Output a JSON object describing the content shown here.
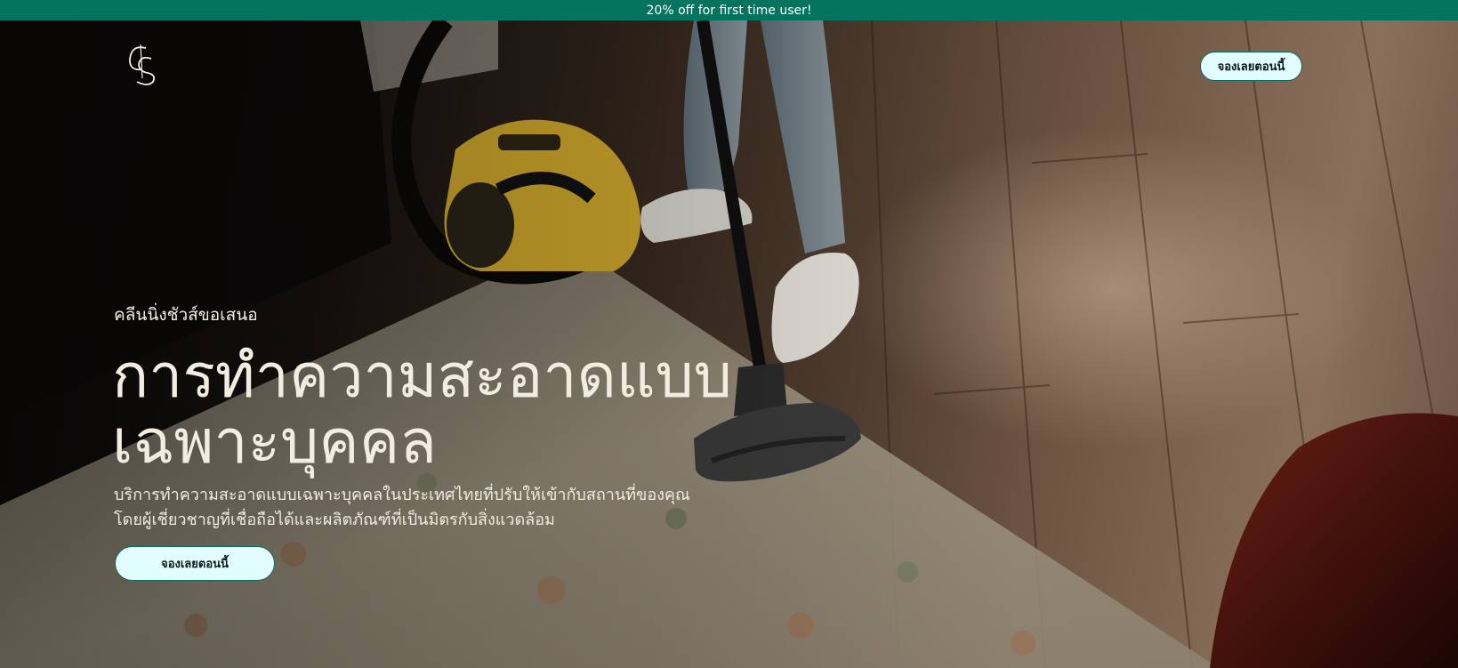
{
  "promo": {
    "text": "20% off for first time user!"
  },
  "header": {
    "logo_icon": "cs-monogram-logo",
    "cta_label": "จองเลยตอนนี้"
  },
  "hero": {
    "eyebrow": "คลีนนิ่งชัวส์ขอเสนอ",
    "title_line1": "การทำความสะอาดแบบ",
    "title_line2": "เฉพาะบุคคล",
    "description_line1": "บริการทำความสะอาดแบบเฉพาะบุคคลในประเทศไทยที่ปรับให้เข้ากับสถานที่ของคุณ",
    "description_line2": "โดยผู้เชี่ยวชาญที่เชื่อถือได้และผลิตภัณฑ์ที่เป็นมิตรกับสิ่งแวดล้อม",
    "cta_label": "จองเลยตอนนี้"
  },
  "colors": {
    "promo_bar": "#05745f",
    "button_bg": "#e2fdff",
    "button_border": "#0b6b57",
    "hero_text": "#f2ede0"
  }
}
